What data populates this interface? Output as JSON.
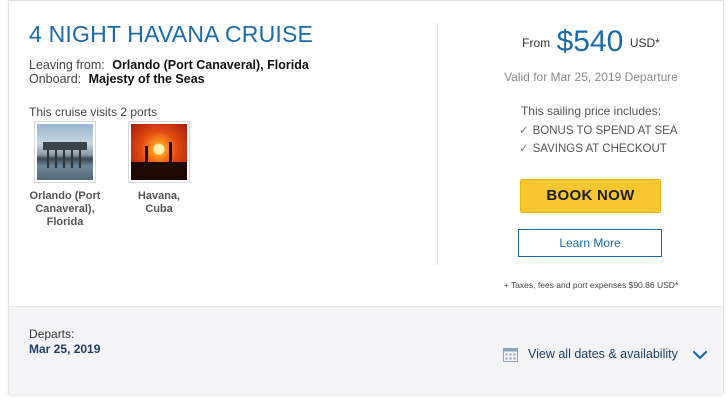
{
  "title": "4 NIGHT HAVANA CRUISE",
  "itinerary": {
    "leaving_label": "Leaving from:",
    "leaving_value": "Orlando (Port Canaveral), Florida",
    "onboard_label": "Onboard:",
    "onboard_value": "Majesty of the Seas"
  },
  "visits_text": "This cruise visits 2 ports",
  "ports": [
    {
      "line1": "Orlando (Port",
      "line2": "Canaveral),",
      "line3": "Florida"
    },
    {
      "line1": "Havana,",
      "line2": "Cuba"
    }
  ],
  "pricing": {
    "from": "From",
    "amount": "$540",
    "currency": "USD*",
    "valid": "Valid for Mar 25, 2019 Departure",
    "includes_heading": "This sailing price includes:",
    "includes": [
      "BONUS TO SPEND AT SEA",
      "SAVINGS AT CHECKOUT"
    ],
    "check_glyph": "✓",
    "book_label": "BOOK NOW",
    "learn_label": "Learn More",
    "taxes": "+ Taxes, fees and port expenses $90.86 USD*"
  },
  "footer": {
    "departs_label": "Departs:",
    "departs_value": "Mar 25, 2019",
    "view_all_label": "View all dates & availability",
    "icons": {
      "calendar": "calendar-icon",
      "chevron": "chevron-down-icon"
    }
  },
  "colors": {
    "accent_blue": "#1a6bab",
    "cta_yellow": "#f8c630",
    "footer_bg": "#f4f4f6",
    "navy_text": "#1d3f66"
  }
}
